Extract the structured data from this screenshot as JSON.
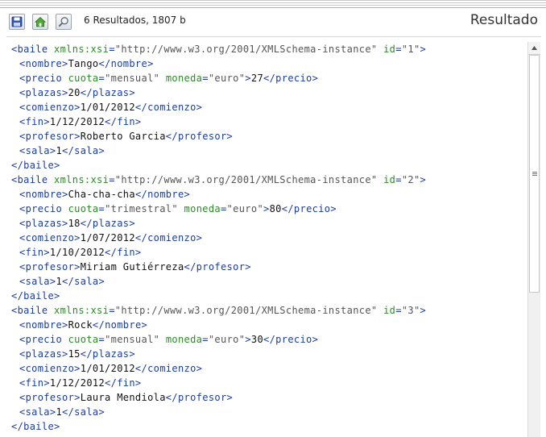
{
  "toolbar": {
    "buttons": [
      {
        "name": "save",
        "icon": "floppy-disk-icon"
      },
      {
        "name": "home",
        "icon": "home-icon"
      },
      {
        "name": "search",
        "icon": "magnifier-icon"
      }
    ],
    "summary": "6 Resultados, 1807 b"
  },
  "panel": {
    "title": "Resultado"
  },
  "colors": {
    "tag": "#1b3d9c",
    "attribute_name": "#2d8a28",
    "attribute_value": "#555555",
    "text": "#111111"
  },
  "records": [
    {
      "xsi": "\"http://www.w3.org/2001/XMLSchema-instance\"",
      "id": "\"1\"",
      "nombre": "Tango",
      "cuota": "\"mensual\"",
      "moneda": "\"euro\"",
      "precio": "27",
      "plazas": "20",
      "comienzo": "1/01/2012",
      "fin": "1/12/2012",
      "profesor": "Roberto Garcia",
      "sala": "1"
    },
    {
      "xsi": "\"http://www.w3.org/2001/XMLSchema-instance\"",
      "id": "\"2\"",
      "nombre": "Cha-cha-cha",
      "cuota": "\"trimestral\"",
      "moneda": "\"euro\"",
      "precio": "80",
      "plazas": "18",
      "comienzo": "1/07/2012",
      "fin": "1/10/2012",
      "profesor": "Miriam Gutiérreza",
      "sala": "1"
    },
    {
      "xsi": "\"http://www.w3.org/2001/XMLSchema-instance\"",
      "id": "\"3\"",
      "nombre": "Rock",
      "cuota": "\"mensual\"",
      "moneda": "\"euro\"",
      "precio": "30",
      "plazas": "15",
      "comienzo": "1/01/2012",
      "fin": "1/12/2012",
      "profesor": "Laura Mendiola",
      "sala": "1"
    }
  ]
}
